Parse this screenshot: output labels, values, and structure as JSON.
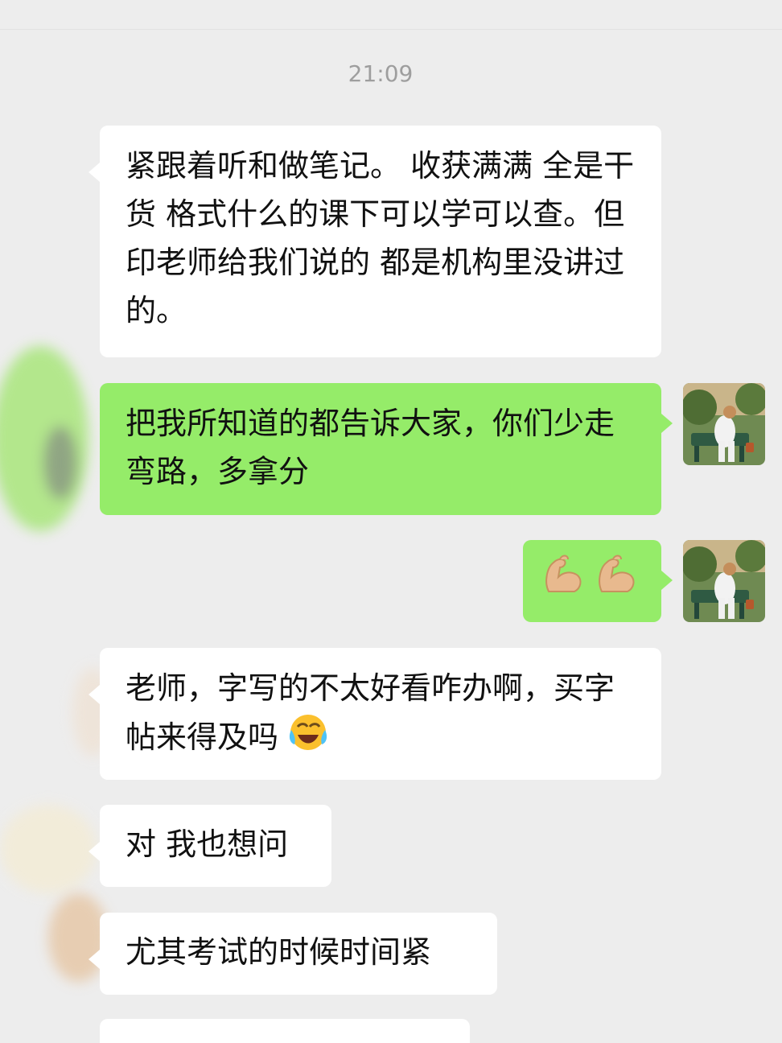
{
  "chat": {
    "timestamp": "21:09",
    "messages": [
      {
        "side": "in",
        "text": "紧跟着听和做笔记。 收获满满 全是干货 格式什么的课下可以学可以查。但印老师给我们说的 都是机构里没讲过的。"
      },
      {
        "side": "out",
        "text": "把我所知道的都告诉大家，你们少走弯路，多拿分"
      },
      {
        "side": "out",
        "emoji": [
          "flexed-biceps",
          "flexed-biceps"
        ]
      },
      {
        "side": "in",
        "text": "老师，字写的不太好看咋办啊，买字帖来得及吗",
        "emoji": "face-with-tears-of-joy"
      },
      {
        "side": "in",
        "text": "对 我也想问"
      },
      {
        "side": "in",
        "text": "尤其考试的时候时间紧"
      }
    ]
  },
  "colors": {
    "background": "#ededed",
    "incoming_bubble": "#ffffff",
    "outgoing_bubble": "#95ec69",
    "timestamp_text": "#9e9e9e"
  }
}
